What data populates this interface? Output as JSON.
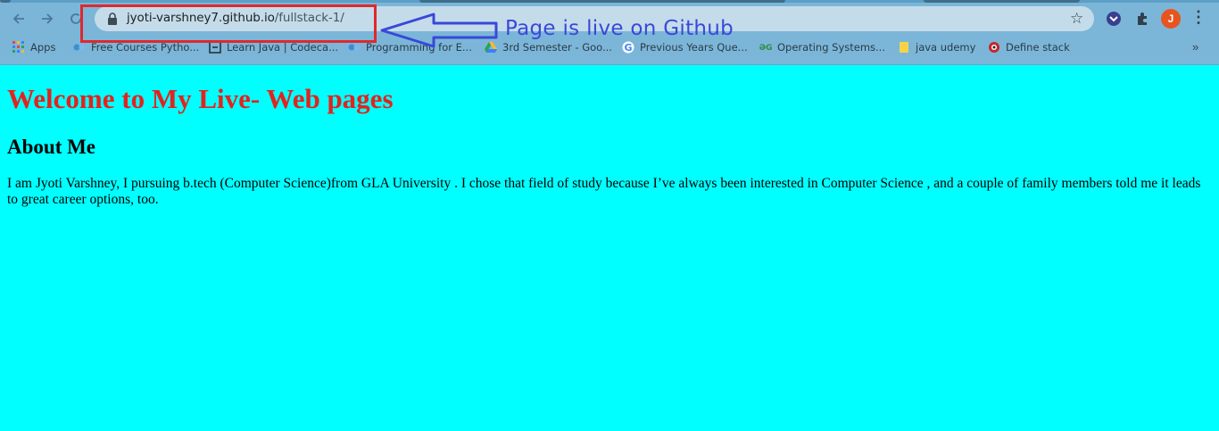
{
  "browser": {
    "url_host": "jyoti-varshney7.github.io",
    "url_path": "/fullstack-1/",
    "avatar_letter": "J",
    "bookmarks": [
      {
        "label": "Apps",
        "icon": "apps-grid-icon"
      },
      {
        "label": "Free Courses Pytho...",
        "icon": "course-icon"
      },
      {
        "label": "Learn Java | Codeca...",
        "icon": "codecademy-icon"
      },
      {
        "label": "Programming for E...",
        "icon": "course-icon"
      },
      {
        "label": "3rd Semester - Goo...",
        "icon": "google-drive-icon"
      },
      {
        "label": "Previous Years Que...",
        "icon": "google-icon"
      },
      {
        "label": "Operating Systems...",
        "icon": "geeksforgeeks-icon"
      },
      {
        "label": "java udemy",
        "icon": "folder-icon"
      },
      {
        "label": "Define stack",
        "icon": "site-icon"
      }
    ],
    "more_bookmarks": "»"
  },
  "annotation": {
    "text": "Page is live on Github",
    "box_color": "#e0282d",
    "arrow_color": "#3a48d8"
  },
  "page": {
    "background": "#00ffff",
    "title": "Welcome to My Live- Web pages",
    "title_color": "#e3231d",
    "heading": "About Me",
    "paragraph": "I am Jyoti Varshney, I pursuing b.tech (Computer Science)from GLA University . I chose that field of study because I’ve always been interested in Computer Science , and a couple of family members told me it leads to great career options, too."
  }
}
